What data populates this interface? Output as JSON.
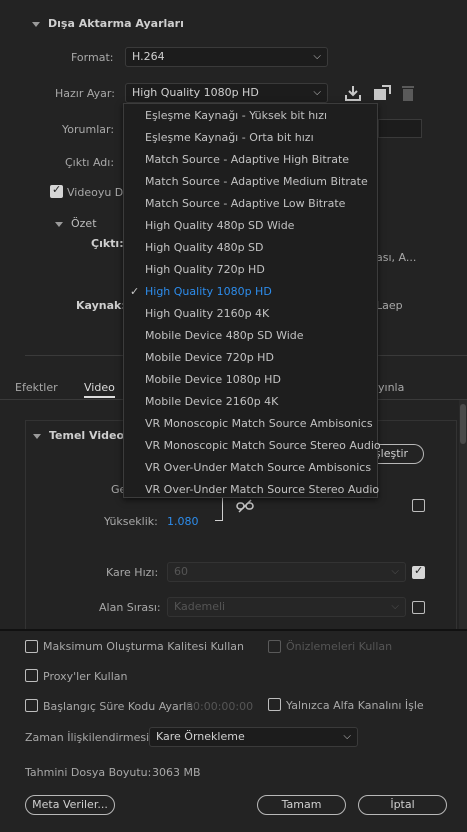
{
  "export_settings": {
    "title": "Dışa Aktarma Ayarları",
    "format_label": "Format:",
    "format_value": "H.264",
    "preset_label": "Hazır Ayar:",
    "preset_value": "High Quality 1080p HD",
    "comments_label": "Yorumlar:",
    "output_name_label": "Çıktı Adı:",
    "export_video_label": "Videoyu Dı",
    "summary_title": "Özet",
    "output_label": "Çıktı:",
    "output_partial": "ası, A...",
    "source_label": "Kaynak:",
    "source_partial": "Laep"
  },
  "preset_menu": {
    "items": [
      "Eşleşme Kaynağı - Yüksek bit hızı",
      "Eşleşme Kaynağı - Orta bit hızı",
      "Match Source - Adaptive High Bitrate",
      "Match Source - Adaptive Medium Bitrate",
      "Match Source - Adaptive Low Bitrate",
      "High Quality 480p SD Wide",
      "High Quality 480p SD",
      "High Quality 720p HD",
      "High Quality 1080p HD",
      "High Quality 2160p 4K",
      "Mobile Device 480p SD Wide",
      "Mobile Device 720p HD",
      "Mobile Device 1080p HD",
      "Mobile Device 2160p 4K",
      "VR Monoscopic Match Source Ambisonics",
      "VR Monoscopic Match Source Stereo Audio",
      "VR Over-Under Match Source Ambisonics",
      "VR Over-Under Match Source Stereo Audio"
    ],
    "selected_check": "✓"
  },
  "tabs": {
    "effects": "Efektler",
    "video": "Video",
    "publish_partial": "yınla"
  },
  "basic_video": {
    "title": "Temel Video A",
    "match_partial": "şleştir",
    "width_partial": "Ge",
    "height_label": "Yükseklik:",
    "height_value": "1.080",
    "frame_rate_label": "Kare Hızı:",
    "frame_rate_value": "60",
    "field_order_label": "Alan Sırası:",
    "field_order_value": "Kademeli"
  },
  "bottom": {
    "max_render_quality": "Maksimum Oluşturma Kalitesi Kullan",
    "use_previews": "Önizlemeleri Kullan",
    "use_proxies": "Proxy'ler Kullan",
    "set_start_timecode": "Başlangıç Süre Kodu Ayarla",
    "timecode_value": "00:00:00:00",
    "render_alpha_only": "Yalnızca Alfa Kanalını İşle",
    "time_interpolation_label": "Zaman İlişkilendirmesi:",
    "time_interpolation_value": "Kare Örnekleme",
    "file_size_label": "Tahmini Dosya Boyutu:",
    "file_size_value": "3063 MB",
    "metadata_button": "Meta Veriler...",
    "ok_button": "Tamam",
    "cancel_button": "İptal"
  }
}
